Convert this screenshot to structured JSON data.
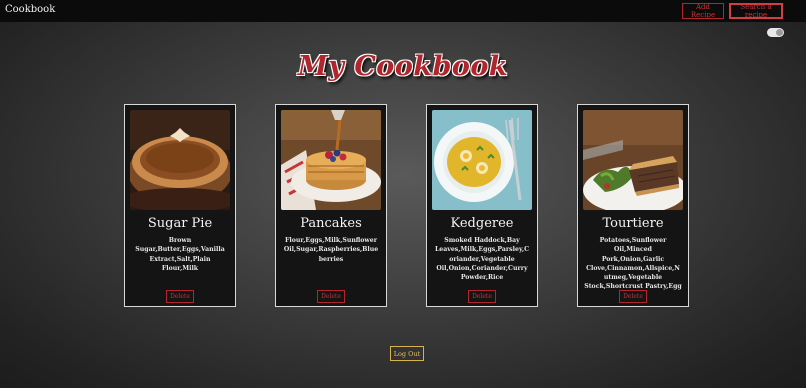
{
  "navbar": {
    "brand": "Cookbook",
    "add_recipe": "Add Recipe",
    "search_recipe": "Search a recipe"
  },
  "theme_toggle": {
    "state": "on"
  },
  "page_title": "My Cookbook",
  "recipes": [
    {
      "name": "Sugar Pie",
      "ingredients": "Brown Sugar,Butter,Eggs,Vanilla Extract,Salt,Plain Flour,Milk",
      "delete_label": "Delete",
      "image_icon": "pie-photo"
    },
    {
      "name": "Pancakes",
      "ingredients": "Flour,Eggs,Milk,Sunflower Oil,Sugar,Raspberries,Blueberries",
      "delete_label": "Delete",
      "image_icon": "pancakes-photo"
    },
    {
      "name": "Kedgeree",
      "ingredients": "Smoked Haddock,Bay Leaves,Milk,Eggs,Parsley,Coriander,Vegetable Oil,Onion,Coriander,Curry Powder,Rice",
      "delete_label": "Delete",
      "image_icon": "kedgeree-photo"
    },
    {
      "name": "Tourtiere",
      "ingredients": "Potatoes,Sunflower Oil,Minced Pork,Onion,Garlic Clove,Cinnamon,Allspice,Nutmeg,Vegetable Stock,Shortcrust Pastry,Egg",
      "delete_label": "Delete",
      "image_icon": "meat-pie-photo"
    }
  ],
  "logout_label": "Log Out",
  "colors": {
    "accent_red": "#b0262c",
    "logout_gold": "#d8b24a",
    "card_bg": "#141414"
  }
}
